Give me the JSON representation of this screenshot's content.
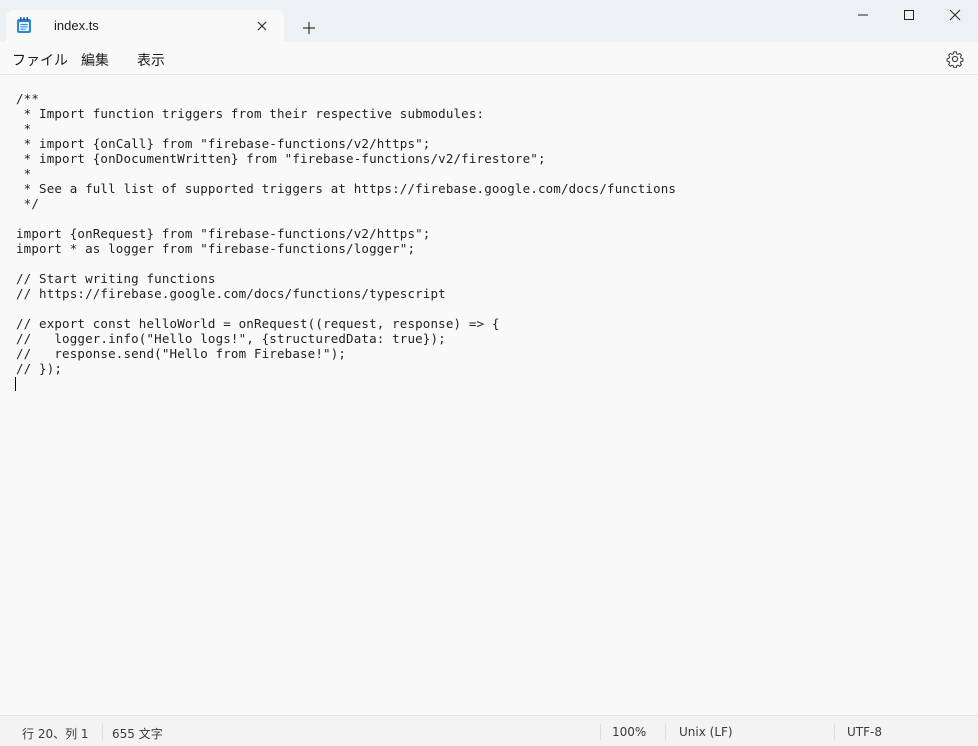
{
  "window": {
    "tab_title": "index.ts",
    "new_tab_symbol": "+",
    "icons": [
      "notepad-icon",
      "close-icon",
      "plus-icon",
      "minimize-icon",
      "maximize-icon",
      "close-window-icon",
      "gear-icon"
    ]
  },
  "menu": {
    "file": "ファイル",
    "edit": "編集",
    "view": "表示"
  },
  "editor": {
    "content": "/**\n * Import function triggers from their respective submodules:\n *\n * import {onCall} from \"firebase-functions/v2/https\";\n * import {onDocumentWritten} from \"firebase-functions/v2/firestore\";\n *\n * See a full list of supported triggers at https://firebase.google.com/docs/functions\n */\n\nimport {onRequest} from \"firebase-functions/v2/https\";\nimport * as logger from \"firebase-functions/logger\";\n\n// Start writing functions\n// https://firebase.google.com/docs/functions/typescript\n\n// export const helloWorld = onRequest((request, response) => {\n//   logger.info(\"Hello logs!\", {structuredData: true});\n//   response.send(\"Hello from Firebase!\");\n// });"
  },
  "status": {
    "position": "行 20、列 1",
    "char_count": "655 文字",
    "zoom": "100%",
    "line_ending": "Unix (LF)",
    "encoding": "UTF-8"
  },
  "colors": {
    "titlebar_bg": "#eef1f4",
    "editor_bg": "#f9f9f9",
    "statusbar_bg": "#f3f3f3",
    "notepad_icon": "#2b88d8"
  }
}
